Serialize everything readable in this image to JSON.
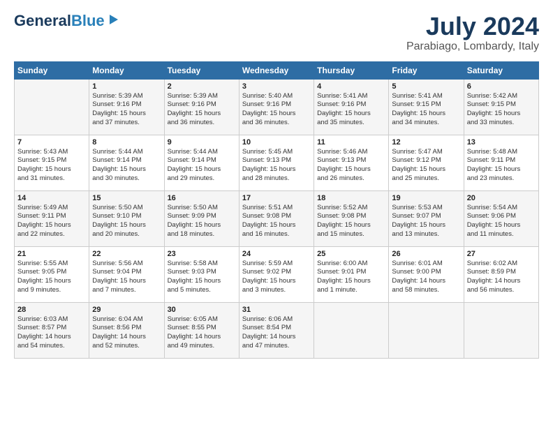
{
  "header": {
    "logo_line1": "General",
    "logo_line2": "Blue",
    "month_year": "July 2024",
    "location": "Parabiago, Lombardy, Italy"
  },
  "columns": [
    "Sunday",
    "Monday",
    "Tuesday",
    "Wednesday",
    "Thursday",
    "Friday",
    "Saturday"
  ],
  "weeks": [
    [
      {
        "day": "",
        "info": ""
      },
      {
        "day": "1",
        "info": "Sunrise: 5:39 AM\nSunset: 9:16 PM\nDaylight: 15 hours\nand 37 minutes."
      },
      {
        "day": "2",
        "info": "Sunrise: 5:39 AM\nSunset: 9:16 PM\nDaylight: 15 hours\nand 36 minutes."
      },
      {
        "day": "3",
        "info": "Sunrise: 5:40 AM\nSunset: 9:16 PM\nDaylight: 15 hours\nand 36 minutes."
      },
      {
        "day": "4",
        "info": "Sunrise: 5:41 AM\nSunset: 9:16 PM\nDaylight: 15 hours\nand 35 minutes."
      },
      {
        "day": "5",
        "info": "Sunrise: 5:41 AM\nSunset: 9:15 PM\nDaylight: 15 hours\nand 34 minutes."
      },
      {
        "day": "6",
        "info": "Sunrise: 5:42 AM\nSunset: 9:15 PM\nDaylight: 15 hours\nand 33 minutes."
      }
    ],
    [
      {
        "day": "7",
        "info": "Sunrise: 5:43 AM\nSunset: 9:15 PM\nDaylight: 15 hours\nand 31 minutes."
      },
      {
        "day": "8",
        "info": "Sunrise: 5:44 AM\nSunset: 9:14 PM\nDaylight: 15 hours\nand 30 minutes."
      },
      {
        "day": "9",
        "info": "Sunrise: 5:44 AM\nSunset: 9:14 PM\nDaylight: 15 hours\nand 29 minutes."
      },
      {
        "day": "10",
        "info": "Sunrise: 5:45 AM\nSunset: 9:13 PM\nDaylight: 15 hours\nand 28 minutes."
      },
      {
        "day": "11",
        "info": "Sunrise: 5:46 AM\nSunset: 9:13 PM\nDaylight: 15 hours\nand 26 minutes."
      },
      {
        "day": "12",
        "info": "Sunrise: 5:47 AM\nSunset: 9:12 PM\nDaylight: 15 hours\nand 25 minutes."
      },
      {
        "day": "13",
        "info": "Sunrise: 5:48 AM\nSunset: 9:11 PM\nDaylight: 15 hours\nand 23 minutes."
      }
    ],
    [
      {
        "day": "14",
        "info": "Sunrise: 5:49 AM\nSunset: 9:11 PM\nDaylight: 15 hours\nand 22 minutes."
      },
      {
        "day": "15",
        "info": "Sunrise: 5:50 AM\nSunset: 9:10 PM\nDaylight: 15 hours\nand 20 minutes."
      },
      {
        "day": "16",
        "info": "Sunrise: 5:50 AM\nSunset: 9:09 PM\nDaylight: 15 hours\nand 18 minutes."
      },
      {
        "day": "17",
        "info": "Sunrise: 5:51 AM\nSunset: 9:08 PM\nDaylight: 15 hours\nand 16 minutes."
      },
      {
        "day": "18",
        "info": "Sunrise: 5:52 AM\nSunset: 9:08 PM\nDaylight: 15 hours\nand 15 minutes."
      },
      {
        "day": "19",
        "info": "Sunrise: 5:53 AM\nSunset: 9:07 PM\nDaylight: 15 hours\nand 13 minutes."
      },
      {
        "day": "20",
        "info": "Sunrise: 5:54 AM\nSunset: 9:06 PM\nDaylight: 15 hours\nand 11 minutes."
      }
    ],
    [
      {
        "day": "21",
        "info": "Sunrise: 5:55 AM\nSunset: 9:05 PM\nDaylight: 15 hours\nand 9 minutes."
      },
      {
        "day": "22",
        "info": "Sunrise: 5:56 AM\nSunset: 9:04 PM\nDaylight: 15 hours\nand 7 minutes."
      },
      {
        "day": "23",
        "info": "Sunrise: 5:58 AM\nSunset: 9:03 PM\nDaylight: 15 hours\nand 5 minutes."
      },
      {
        "day": "24",
        "info": "Sunrise: 5:59 AM\nSunset: 9:02 PM\nDaylight: 15 hours\nand 3 minutes."
      },
      {
        "day": "25",
        "info": "Sunrise: 6:00 AM\nSunset: 9:01 PM\nDaylight: 15 hours\nand 1 minute."
      },
      {
        "day": "26",
        "info": "Sunrise: 6:01 AM\nSunset: 9:00 PM\nDaylight: 14 hours\nand 58 minutes."
      },
      {
        "day": "27",
        "info": "Sunrise: 6:02 AM\nSunset: 8:59 PM\nDaylight: 14 hours\nand 56 minutes."
      }
    ],
    [
      {
        "day": "28",
        "info": "Sunrise: 6:03 AM\nSunset: 8:57 PM\nDaylight: 14 hours\nand 54 minutes."
      },
      {
        "day": "29",
        "info": "Sunrise: 6:04 AM\nSunset: 8:56 PM\nDaylight: 14 hours\nand 52 minutes."
      },
      {
        "day": "30",
        "info": "Sunrise: 6:05 AM\nSunset: 8:55 PM\nDaylight: 14 hours\nand 49 minutes."
      },
      {
        "day": "31",
        "info": "Sunrise: 6:06 AM\nSunset: 8:54 PM\nDaylight: 14 hours\nand 47 minutes."
      },
      {
        "day": "",
        "info": ""
      },
      {
        "day": "",
        "info": ""
      },
      {
        "day": "",
        "info": ""
      }
    ]
  ]
}
